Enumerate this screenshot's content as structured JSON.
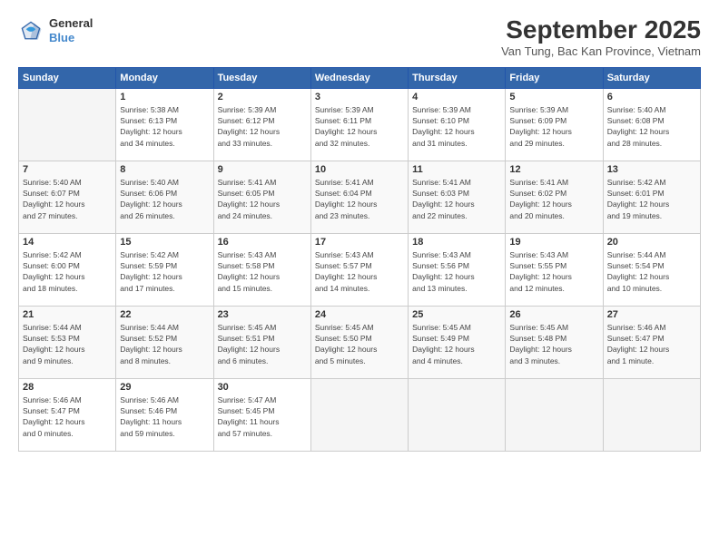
{
  "header": {
    "logo_general": "General",
    "logo_blue": "Blue",
    "month_title": "September 2025",
    "subtitle": "Van Tung, Bac Kan Province, Vietnam"
  },
  "weekdays": [
    "Sunday",
    "Monday",
    "Tuesday",
    "Wednesday",
    "Thursday",
    "Friday",
    "Saturday"
  ],
  "weeks": [
    [
      {
        "day": "",
        "info": ""
      },
      {
        "day": "1",
        "info": "Sunrise: 5:38 AM\nSunset: 6:13 PM\nDaylight: 12 hours\nand 34 minutes."
      },
      {
        "day": "2",
        "info": "Sunrise: 5:39 AM\nSunset: 6:12 PM\nDaylight: 12 hours\nand 33 minutes."
      },
      {
        "day": "3",
        "info": "Sunrise: 5:39 AM\nSunset: 6:11 PM\nDaylight: 12 hours\nand 32 minutes."
      },
      {
        "day": "4",
        "info": "Sunrise: 5:39 AM\nSunset: 6:10 PM\nDaylight: 12 hours\nand 31 minutes."
      },
      {
        "day": "5",
        "info": "Sunrise: 5:39 AM\nSunset: 6:09 PM\nDaylight: 12 hours\nand 29 minutes."
      },
      {
        "day": "6",
        "info": "Sunrise: 5:40 AM\nSunset: 6:08 PM\nDaylight: 12 hours\nand 28 minutes."
      }
    ],
    [
      {
        "day": "7",
        "info": "Sunrise: 5:40 AM\nSunset: 6:07 PM\nDaylight: 12 hours\nand 27 minutes."
      },
      {
        "day": "8",
        "info": "Sunrise: 5:40 AM\nSunset: 6:06 PM\nDaylight: 12 hours\nand 26 minutes."
      },
      {
        "day": "9",
        "info": "Sunrise: 5:41 AM\nSunset: 6:05 PM\nDaylight: 12 hours\nand 24 minutes."
      },
      {
        "day": "10",
        "info": "Sunrise: 5:41 AM\nSunset: 6:04 PM\nDaylight: 12 hours\nand 23 minutes."
      },
      {
        "day": "11",
        "info": "Sunrise: 5:41 AM\nSunset: 6:03 PM\nDaylight: 12 hours\nand 22 minutes."
      },
      {
        "day": "12",
        "info": "Sunrise: 5:41 AM\nSunset: 6:02 PM\nDaylight: 12 hours\nand 20 minutes."
      },
      {
        "day": "13",
        "info": "Sunrise: 5:42 AM\nSunset: 6:01 PM\nDaylight: 12 hours\nand 19 minutes."
      }
    ],
    [
      {
        "day": "14",
        "info": "Sunrise: 5:42 AM\nSunset: 6:00 PM\nDaylight: 12 hours\nand 18 minutes."
      },
      {
        "day": "15",
        "info": "Sunrise: 5:42 AM\nSunset: 5:59 PM\nDaylight: 12 hours\nand 17 minutes."
      },
      {
        "day": "16",
        "info": "Sunrise: 5:43 AM\nSunset: 5:58 PM\nDaylight: 12 hours\nand 15 minutes."
      },
      {
        "day": "17",
        "info": "Sunrise: 5:43 AM\nSunset: 5:57 PM\nDaylight: 12 hours\nand 14 minutes."
      },
      {
        "day": "18",
        "info": "Sunrise: 5:43 AM\nSunset: 5:56 PM\nDaylight: 12 hours\nand 13 minutes."
      },
      {
        "day": "19",
        "info": "Sunrise: 5:43 AM\nSunset: 5:55 PM\nDaylight: 12 hours\nand 12 minutes."
      },
      {
        "day": "20",
        "info": "Sunrise: 5:44 AM\nSunset: 5:54 PM\nDaylight: 12 hours\nand 10 minutes."
      }
    ],
    [
      {
        "day": "21",
        "info": "Sunrise: 5:44 AM\nSunset: 5:53 PM\nDaylight: 12 hours\nand 9 minutes."
      },
      {
        "day": "22",
        "info": "Sunrise: 5:44 AM\nSunset: 5:52 PM\nDaylight: 12 hours\nand 8 minutes."
      },
      {
        "day": "23",
        "info": "Sunrise: 5:45 AM\nSunset: 5:51 PM\nDaylight: 12 hours\nand 6 minutes."
      },
      {
        "day": "24",
        "info": "Sunrise: 5:45 AM\nSunset: 5:50 PM\nDaylight: 12 hours\nand 5 minutes."
      },
      {
        "day": "25",
        "info": "Sunrise: 5:45 AM\nSunset: 5:49 PM\nDaylight: 12 hours\nand 4 minutes."
      },
      {
        "day": "26",
        "info": "Sunrise: 5:45 AM\nSunset: 5:48 PM\nDaylight: 12 hours\nand 3 minutes."
      },
      {
        "day": "27",
        "info": "Sunrise: 5:46 AM\nSunset: 5:47 PM\nDaylight: 12 hours\nand 1 minute."
      }
    ],
    [
      {
        "day": "28",
        "info": "Sunrise: 5:46 AM\nSunset: 5:47 PM\nDaylight: 12 hours\nand 0 minutes."
      },
      {
        "day": "29",
        "info": "Sunrise: 5:46 AM\nSunset: 5:46 PM\nDaylight: 11 hours\nand 59 minutes."
      },
      {
        "day": "30",
        "info": "Sunrise: 5:47 AM\nSunset: 5:45 PM\nDaylight: 11 hours\nand 57 minutes."
      },
      {
        "day": "",
        "info": ""
      },
      {
        "day": "",
        "info": ""
      },
      {
        "day": "",
        "info": ""
      },
      {
        "day": "",
        "info": ""
      }
    ]
  ]
}
